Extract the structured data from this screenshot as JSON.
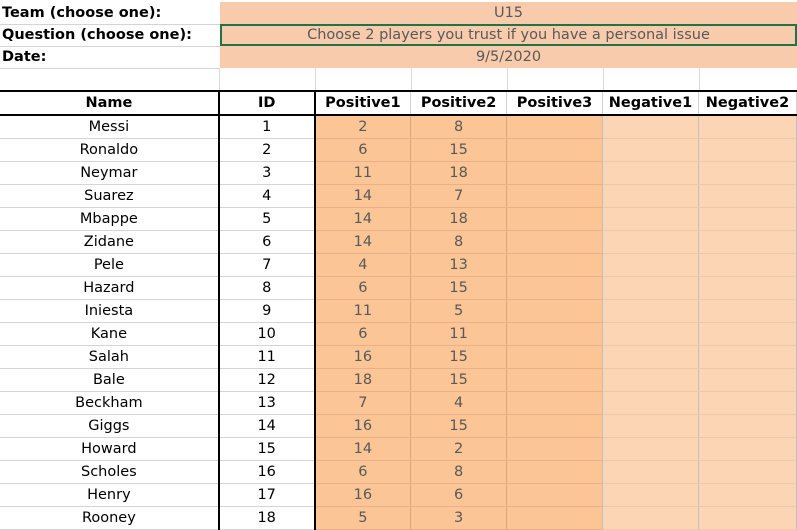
{
  "header": {
    "team_label": "Team (choose one):",
    "team_value": "U15",
    "question_label": "Question (choose one):",
    "question_value": "Choose 2 players you trust if you have a personal issue",
    "date_label": "Date:",
    "date_value": "9/5/2020"
  },
  "table": {
    "columns": [
      "Name",
      "ID",
      "Positive1",
      "Positive2",
      "Positive3",
      "Negative1",
      "Negative2"
    ],
    "rows": [
      {
        "name": "Messi",
        "id": "1",
        "p1": "2",
        "p2": "8"
      },
      {
        "name": "Ronaldo",
        "id": "2",
        "p1": "6",
        "p2": "15"
      },
      {
        "name": "Neymar",
        "id": "3",
        "p1": "11",
        "p2": "18"
      },
      {
        "name": "Suarez",
        "id": "4",
        "p1": "14",
        "p2": "7"
      },
      {
        "name": "Mbappe",
        "id": "5",
        "p1": "14",
        "p2": "18"
      },
      {
        "name": "Zidane",
        "id": "6",
        "p1": "14",
        "p2": "8"
      },
      {
        "name": "Pele",
        "id": "7",
        "p1": "4",
        "p2": "13"
      },
      {
        "name": "Hazard",
        "id": "8",
        "p1": "6",
        "p2": "15"
      },
      {
        "name": "Iniesta",
        "id": "9",
        "p1": "11",
        "p2": "5"
      },
      {
        "name": "Kane",
        "id": "10",
        "p1": "6",
        "p2": "11"
      },
      {
        "name": "Salah",
        "id": "11",
        "p1": "16",
        "p2": "15"
      },
      {
        "name": "Bale",
        "id": "12",
        "p1": "18",
        "p2": "15"
      },
      {
        "name": "Beckham",
        "id": "13",
        "p1": "7",
        "p2": "4"
      },
      {
        "name": "Giggs",
        "id": "14",
        "p1": "16",
        "p2": "15"
      },
      {
        "name": "Howard",
        "id": "15",
        "p1": "14",
        "p2": "2"
      },
      {
        "name": "Scholes",
        "id": "16",
        "p1": "6",
        "p2": "8"
      },
      {
        "name": "Henry",
        "id": "17",
        "p1": "16",
        "p2": "6"
      },
      {
        "name": "Rooney",
        "id": "18",
        "p1": "5",
        "p2": "3"
      }
    ]
  },
  "colors": {
    "positive_fill": "#fbc596",
    "negative_fill": "#fcd5b4",
    "header_value_fill": "#f8cbad",
    "selection_border": "#217346"
  }
}
